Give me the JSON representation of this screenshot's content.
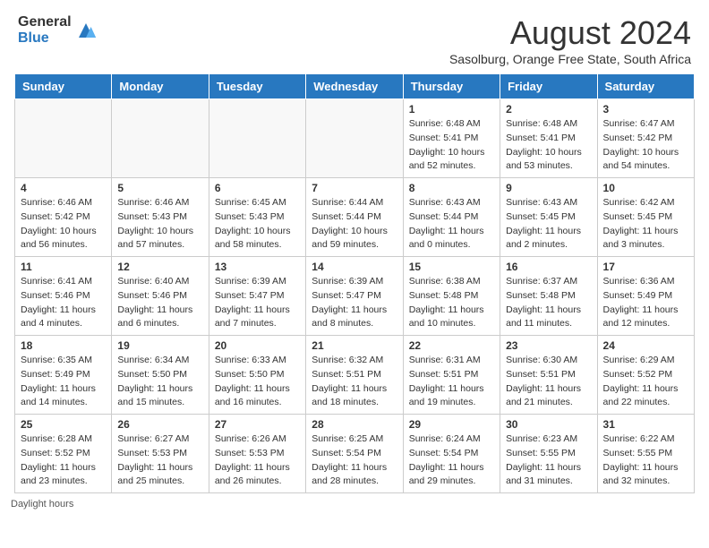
{
  "logo": {
    "general": "General",
    "blue": "Blue"
  },
  "header": {
    "title": "August 2024",
    "subtitle": "Sasolburg, Orange Free State, South Africa"
  },
  "days_of_week": [
    "Sunday",
    "Monday",
    "Tuesday",
    "Wednesday",
    "Thursday",
    "Friday",
    "Saturday"
  ],
  "weeks": [
    [
      {
        "day": "",
        "sunrise": "",
        "sunset": "",
        "daylight": ""
      },
      {
        "day": "",
        "sunrise": "",
        "sunset": "",
        "daylight": ""
      },
      {
        "day": "",
        "sunrise": "",
        "sunset": "",
        "daylight": ""
      },
      {
        "day": "",
        "sunrise": "",
        "sunset": "",
        "daylight": ""
      },
      {
        "day": "1",
        "sunrise": "Sunrise: 6:48 AM",
        "sunset": "Sunset: 5:41 PM",
        "daylight": "Daylight: 10 hours and 52 minutes."
      },
      {
        "day": "2",
        "sunrise": "Sunrise: 6:48 AM",
        "sunset": "Sunset: 5:41 PM",
        "daylight": "Daylight: 10 hours and 53 minutes."
      },
      {
        "day": "3",
        "sunrise": "Sunrise: 6:47 AM",
        "sunset": "Sunset: 5:42 PM",
        "daylight": "Daylight: 10 hours and 54 minutes."
      }
    ],
    [
      {
        "day": "4",
        "sunrise": "Sunrise: 6:46 AM",
        "sunset": "Sunset: 5:42 PM",
        "daylight": "Daylight: 10 hours and 56 minutes."
      },
      {
        "day": "5",
        "sunrise": "Sunrise: 6:46 AM",
        "sunset": "Sunset: 5:43 PM",
        "daylight": "Daylight: 10 hours and 57 minutes."
      },
      {
        "day": "6",
        "sunrise": "Sunrise: 6:45 AM",
        "sunset": "Sunset: 5:43 PM",
        "daylight": "Daylight: 10 hours and 58 minutes."
      },
      {
        "day": "7",
        "sunrise": "Sunrise: 6:44 AM",
        "sunset": "Sunset: 5:44 PM",
        "daylight": "Daylight: 10 hours and 59 minutes."
      },
      {
        "day": "8",
        "sunrise": "Sunrise: 6:43 AM",
        "sunset": "Sunset: 5:44 PM",
        "daylight": "Daylight: 11 hours and 0 minutes."
      },
      {
        "day": "9",
        "sunrise": "Sunrise: 6:43 AM",
        "sunset": "Sunset: 5:45 PM",
        "daylight": "Daylight: 11 hours and 2 minutes."
      },
      {
        "day": "10",
        "sunrise": "Sunrise: 6:42 AM",
        "sunset": "Sunset: 5:45 PM",
        "daylight": "Daylight: 11 hours and 3 minutes."
      }
    ],
    [
      {
        "day": "11",
        "sunrise": "Sunrise: 6:41 AM",
        "sunset": "Sunset: 5:46 PM",
        "daylight": "Daylight: 11 hours and 4 minutes."
      },
      {
        "day": "12",
        "sunrise": "Sunrise: 6:40 AM",
        "sunset": "Sunset: 5:46 PM",
        "daylight": "Daylight: 11 hours and 6 minutes."
      },
      {
        "day": "13",
        "sunrise": "Sunrise: 6:39 AM",
        "sunset": "Sunset: 5:47 PM",
        "daylight": "Daylight: 11 hours and 7 minutes."
      },
      {
        "day": "14",
        "sunrise": "Sunrise: 6:39 AM",
        "sunset": "Sunset: 5:47 PM",
        "daylight": "Daylight: 11 hours and 8 minutes."
      },
      {
        "day": "15",
        "sunrise": "Sunrise: 6:38 AM",
        "sunset": "Sunset: 5:48 PM",
        "daylight": "Daylight: 11 hours and 10 minutes."
      },
      {
        "day": "16",
        "sunrise": "Sunrise: 6:37 AM",
        "sunset": "Sunset: 5:48 PM",
        "daylight": "Daylight: 11 hours and 11 minutes."
      },
      {
        "day": "17",
        "sunrise": "Sunrise: 6:36 AM",
        "sunset": "Sunset: 5:49 PM",
        "daylight": "Daylight: 11 hours and 12 minutes."
      }
    ],
    [
      {
        "day": "18",
        "sunrise": "Sunrise: 6:35 AM",
        "sunset": "Sunset: 5:49 PM",
        "daylight": "Daylight: 11 hours and 14 minutes."
      },
      {
        "day": "19",
        "sunrise": "Sunrise: 6:34 AM",
        "sunset": "Sunset: 5:50 PM",
        "daylight": "Daylight: 11 hours and 15 minutes."
      },
      {
        "day": "20",
        "sunrise": "Sunrise: 6:33 AM",
        "sunset": "Sunset: 5:50 PM",
        "daylight": "Daylight: 11 hours and 16 minutes."
      },
      {
        "day": "21",
        "sunrise": "Sunrise: 6:32 AM",
        "sunset": "Sunset: 5:51 PM",
        "daylight": "Daylight: 11 hours and 18 minutes."
      },
      {
        "day": "22",
        "sunrise": "Sunrise: 6:31 AM",
        "sunset": "Sunset: 5:51 PM",
        "daylight": "Daylight: 11 hours and 19 minutes."
      },
      {
        "day": "23",
        "sunrise": "Sunrise: 6:30 AM",
        "sunset": "Sunset: 5:51 PM",
        "daylight": "Daylight: 11 hours and 21 minutes."
      },
      {
        "day": "24",
        "sunrise": "Sunrise: 6:29 AM",
        "sunset": "Sunset: 5:52 PM",
        "daylight": "Daylight: 11 hours and 22 minutes."
      }
    ],
    [
      {
        "day": "25",
        "sunrise": "Sunrise: 6:28 AM",
        "sunset": "Sunset: 5:52 PM",
        "daylight": "Daylight: 11 hours and 23 minutes."
      },
      {
        "day": "26",
        "sunrise": "Sunrise: 6:27 AM",
        "sunset": "Sunset: 5:53 PM",
        "daylight": "Daylight: 11 hours and 25 minutes."
      },
      {
        "day": "27",
        "sunrise": "Sunrise: 6:26 AM",
        "sunset": "Sunset: 5:53 PM",
        "daylight": "Daylight: 11 hours and 26 minutes."
      },
      {
        "day": "28",
        "sunrise": "Sunrise: 6:25 AM",
        "sunset": "Sunset: 5:54 PM",
        "daylight": "Daylight: 11 hours and 28 minutes."
      },
      {
        "day": "29",
        "sunrise": "Sunrise: 6:24 AM",
        "sunset": "Sunset: 5:54 PM",
        "daylight": "Daylight: 11 hours and 29 minutes."
      },
      {
        "day": "30",
        "sunrise": "Sunrise: 6:23 AM",
        "sunset": "Sunset: 5:55 PM",
        "daylight": "Daylight: 11 hours and 31 minutes."
      },
      {
        "day": "31",
        "sunrise": "Sunrise: 6:22 AM",
        "sunset": "Sunset: 5:55 PM",
        "daylight": "Daylight: 11 hours and 32 minutes."
      }
    ]
  ],
  "footer": {
    "note": "Daylight hours"
  }
}
